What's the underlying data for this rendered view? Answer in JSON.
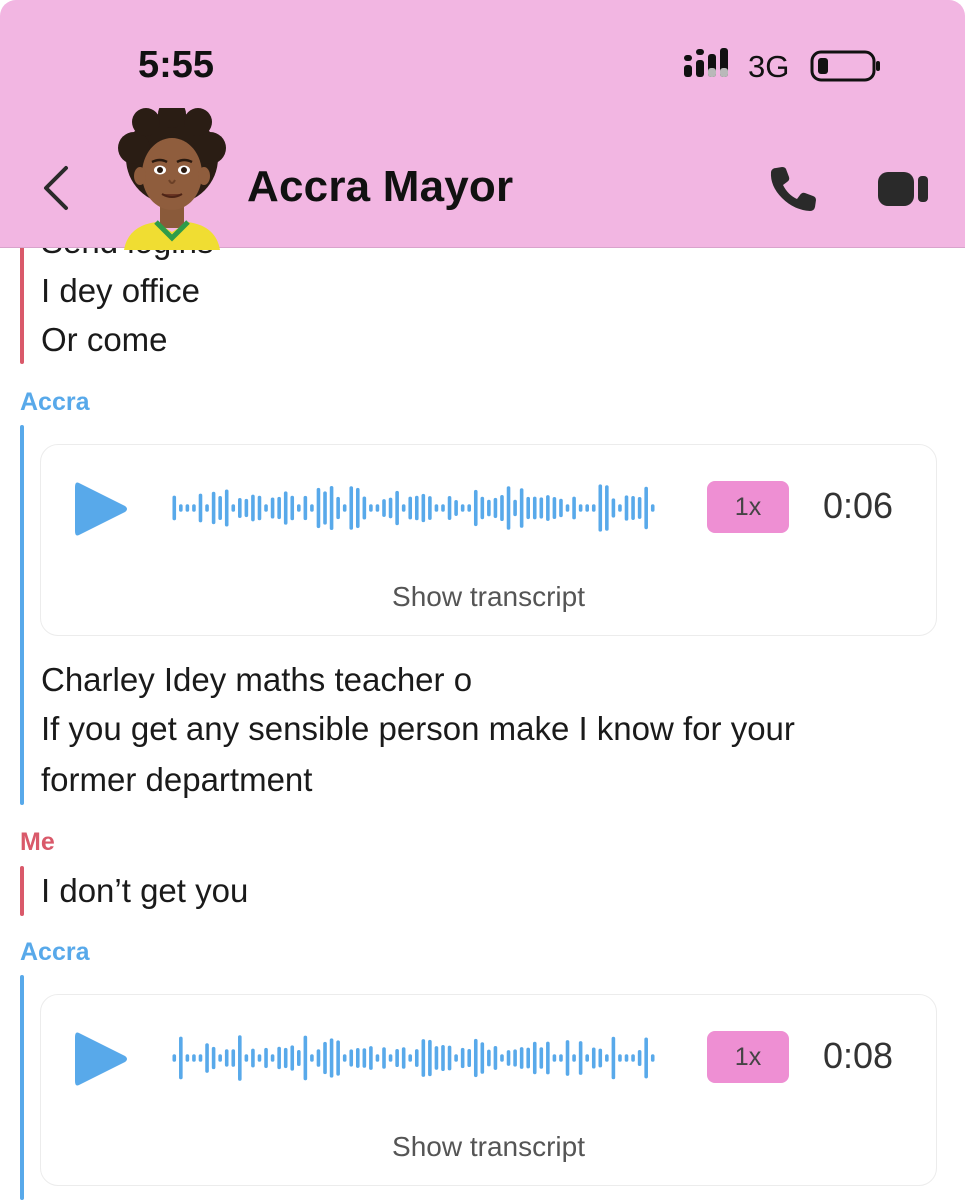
{
  "status_bar": {
    "time": "5:55",
    "network": "3G",
    "signal_icon": "cellular-signal-icon",
    "battery_icon": "battery-low-icon"
  },
  "header": {
    "contact_name": "Accra Mayor",
    "back_icon": "chevron-left-icon",
    "call_icon": "phone-icon",
    "video_icon": "video-camera-icon",
    "background_color": "#f2b6e2"
  },
  "messages": [
    {
      "sender": "",
      "sender_color": "#d9596a",
      "lines": [
        "Send logins",
        "I dey office",
        "Or come"
      ]
    },
    {
      "sender": "Accra",
      "sender_color": "#58a9ea",
      "voice_note": {
        "speed": "1x",
        "duration": "0:06",
        "transcript_label": "Show transcript"
      },
      "lines": [
        "Charley Idey maths teacher o",
        "If you get any sensible person make I know for your",
        "former department"
      ]
    },
    {
      "sender": "Me",
      "sender_color": "#d9596a",
      "lines": [
        "I don’t get you"
      ]
    },
    {
      "sender": "Accra",
      "sender_color": "#58a9ea",
      "voice_note": {
        "speed": "1x",
        "duration": "0:08",
        "transcript_label": "Show transcript"
      }
    }
  ],
  "colors": {
    "accent_blue": "#58a9ea",
    "accent_red": "#d9596a",
    "speed_pill": "#ee8fd3"
  }
}
